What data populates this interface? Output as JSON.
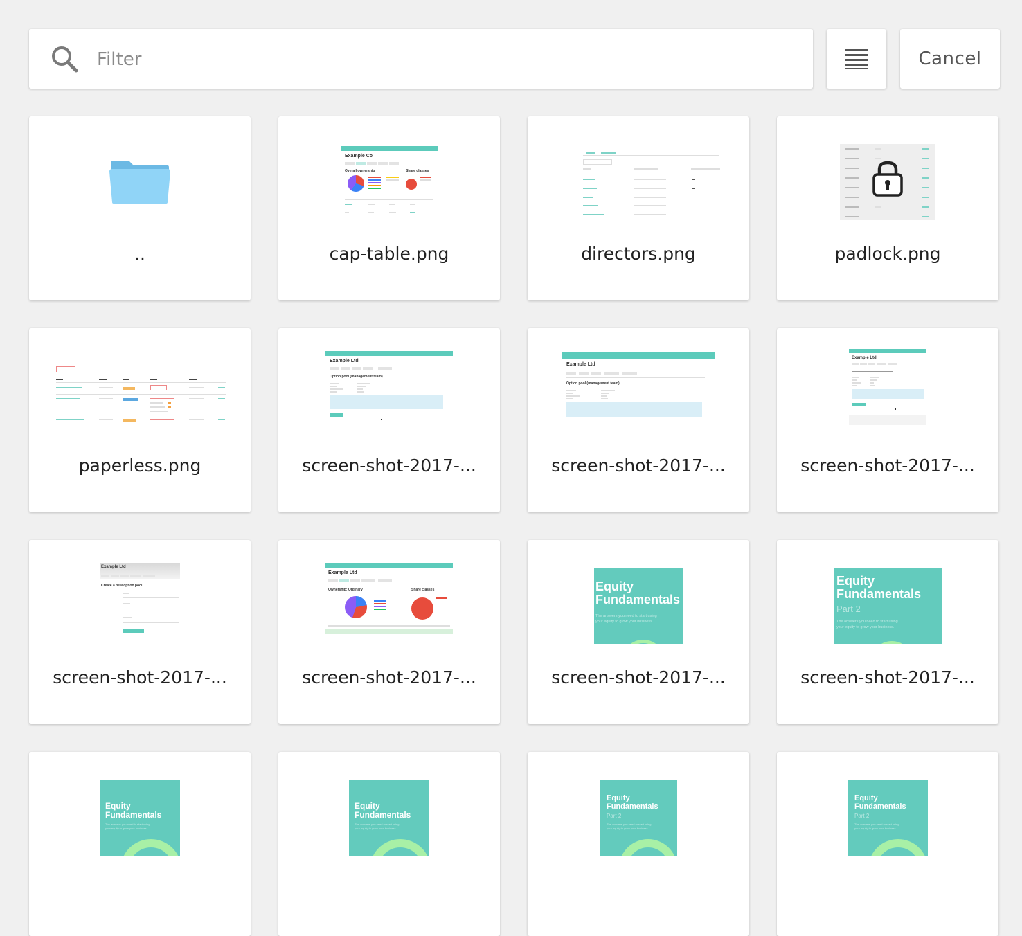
{
  "search": {
    "placeholder": "Filter",
    "value": ""
  },
  "toolbar": {
    "cancel_label": "Cancel"
  },
  "tiles": [
    {
      "name": "..",
      "kind": "folder"
    },
    {
      "name": "cap-table.png",
      "kind": "cap-table"
    },
    {
      "name": "directors.png",
      "kind": "directors"
    },
    {
      "name": "padlock.png",
      "kind": "padlock"
    },
    {
      "name": "paperless.png",
      "kind": "paperless"
    },
    {
      "name": "screen-shot-2017-...",
      "kind": "option-pool-1"
    },
    {
      "name": "screen-shot-2017-...",
      "kind": "option-pool-2"
    },
    {
      "name": "screen-shot-2017-...",
      "kind": "option-pool-3"
    },
    {
      "name": "screen-shot-2017-...",
      "kind": "create-option-pool"
    },
    {
      "name": "screen-shot-2017-...",
      "kind": "ownership"
    },
    {
      "name": "screen-shot-2017-...",
      "kind": "equity-fundamentals"
    },
    {
      "name": "screen-shot-2017-...",
      "kind": "equity-fundamentals-part2"
    },
    {
      "name": "",
      "kind": "equity-fundamentals-small"
    },
    {
      "name": "",
      "kind": "equity-fundamentals-small"
    },
    {
      "name": "",
      "kind": "equity-fundamentals-part2-small"
    },
    {
      "name": "",
      "kind": "equity-fundamentals-part2-small"
    }
  ],
  "thumb_text": {
    "example_co": "Example Co",
    "example_ltd": "Example Ltd",
    "overall_ownership": "Overall ownership",
    "share_classes": "Share classes",
    "option_pool_mgmt": "Option pool (management team)",
    "create_option_pool": "Create a new option pool",
    "ownership_ordinary": "Ownership: Ordinary",
    "equity_title_line1": "Equity",
    "equity_title_line2": "Fundamentals",
    "equity_part": "Part 2",
    "equity_sub_line1": "The answers you need to start using",
    "equity_sub_line2": "your equity to grow your business."
  },
  "colors": {
    "accent_teal": "#5ccbbb",
    "folder_blue": "#8dd2f5",
    "equity_green": "#63cbbd"
  },
  "icons": {
    "search": "search-icon",
    "view_toggle": "list-view-icon",
    "folder": "folder-icon",
    "padlock": "lock-icon"
  }
}
